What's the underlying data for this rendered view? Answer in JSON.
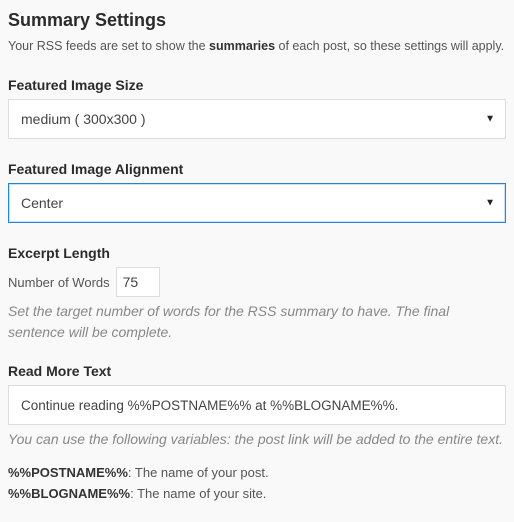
{
  "title": "Summary Settings",
  "intro_pre": "Your RSS feeds are set to show the ",
  "intro_bold": "summaries",
  "intro_post": " of each post, so these settings will apply.",
  "image_size": {
    "label": "Featured Image Size",
    "value": "medium ( 300x300 )"
  },
  "image_align": {
    "label": "Featured Image Alignment",
    "value": "Center"
  },
  "excerpt": {
    "label": "Excerpt Length",
    "words_label": "Number of Words",
    "words_value": "75",
    "help": "Set the target number of words for the RSS summary to have. The final sentence will be complete."
  },
  "readmore": {
    "label": "Read More Text",
    "value": "Continue reading %%POSTNAME%% at %%BLOGNAME%%.",
    "help": "You can use the following variables: the post link will be added to the entire text."
  },
  "vars": {
    "postname_key": "%%POSTNAME%%",
    "postname_desc": ": The name of your post.",
    "blogname_key": "%%BLOGNAME%%",
    "blogname_desc": ": The name of your site."
  }
}
